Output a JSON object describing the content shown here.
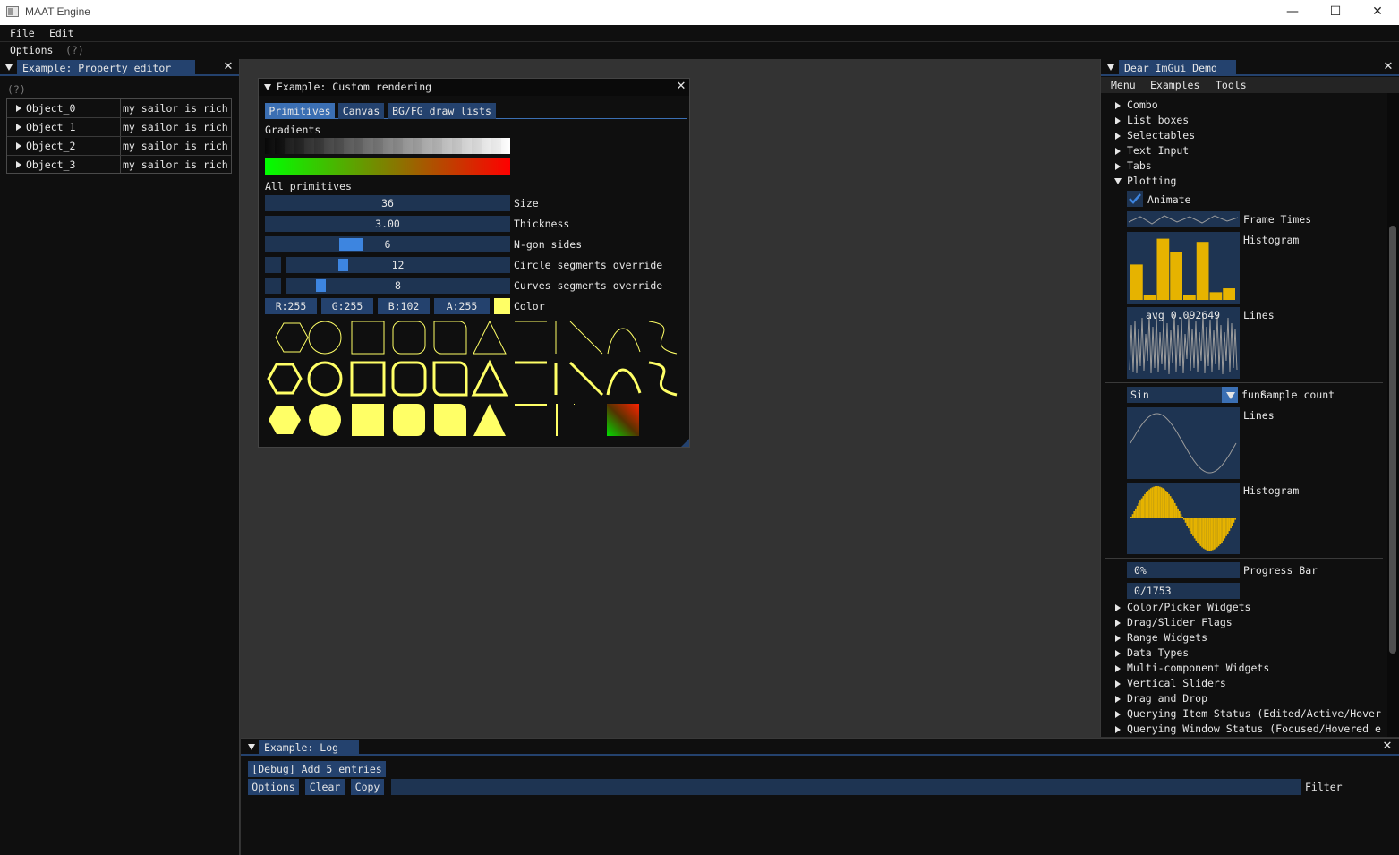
{
  "window": {
    "title": "MAAT Engine",
    "minimize": "—",
    "maximize": "☐",
    "close": "✕"
  },
  "menubar": {
    "items": [
      "File",
      "Edit"
    ]
  },
  "optionsbar": {
    "label": "Options",
    "help": "(?)"
  },
  "property_editor": {
    "tab": "Example: Property editor",
    "help": "(?)",
    "rows": [
      {
        "name": "Object_0",
        "value": "my sailor is rich"
      },
      {
        "name": "Object_1",
        "value": "my sailor is rich"
      },
      {
        "name": "Object_2",
        "value": "my sailor is rich"
      },
      {
        "name": "Object_3",
        "value": "my sailor is rich"
      }
    ]
  },
  "custom_render": {
    "title": "Example: Custom rendering",
    "tabs": [
      "Primitives",
      "Canvas",
      "BG/FG draw lists"
    ],
    "gradients_label": "Gradients",
    "all_primitives_label": "All primitives",
    "size": {
      "value": "36",
      "label": "Size"
    },
    "thickness": {
      "value": "3.00",
      "label": "Thickness"
    },
    "ngon": {
      "value": "6",
      "label": "N-gon sides",
      "fraction": 0.35
    },
    "circle_seg": {
      "value": "12",
      "label": "Circle segments override",
      "fraction": 0.25
    },
    "curve_seg": {
      "value": "8",
      "label": "Curves segments override",
      "fraction": 0.15
    },
    "color": {
      "r": "R:255",
      "g": "G:255",
      "b": "B:102",
      "a": "A:255",
      "label": "Color",
      "hex": "#ffff66"
    }
  },
  "demo": {
    "tab": "Dear ImGui Demo",
    "menu": [
      "Menu",
      "Examples",
      "Tools"
    ],
    "top_items": [
      "Combo",
      "List boxes",
      "Selectables",
      "Text Input",
      "Tabs"
    ],
    "plotting": "Plotting",
    "animate": "Animate",
    "frame_times": "Frame Times",
    "histogram": "Histogram",
    "lines": "Lines",
    "avg": "avg 0.092649",
    "func_value": "Sin",
    "func_label": "func",
    "sample_count": "Sample count",
    "lines2": "Lines",
    "histogram2": "Histogram",
    "progress_value": "0%",
    "progress_label": "Progress Bar",
    "progress_count": "0/1753",
    "bottom_items": [
      "Color/Picker Widgets",
      "Drag/Slider Flags",
      "Range Widgets",
      "Data Types",
      "Multi-component Widgets",
      "Vertical Sliders",
      "Drag and Drop",
      "Querying Item Status (Edited/Active/Hover",
      "Querying Window Status (Focused/Hovered e"
    ],
    "histogram_values": [
      0.55,
      0.08,
      0.95,
      0.75,
      0.08,
      0.9,
      0.12,
      0.18
    ]
  },
  "log": {
    "tab": "Example: Log",
    "debug_btn": "[Debug] Add 5 entries",
    "options": "Options",
    "clear": "Clear",
    "copy": "Copy",
    "filter": "Filter"
  }
}
